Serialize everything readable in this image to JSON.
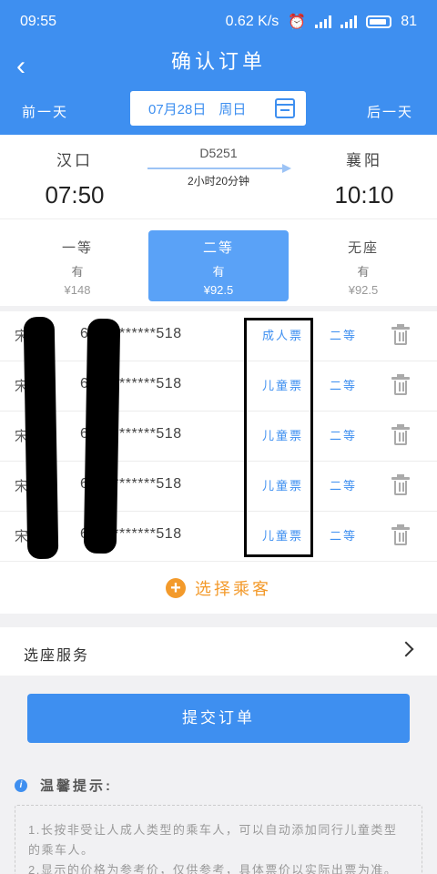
{
  "status_bar": {
    "time": "09:55",
    "speed": "0.62 K/s",
    "battery": "81"
  },
  "header": {
    "title": "确认订单"
  },
  "date_bar": {
    "prev_day": "前一天",
    "date": "07月28日",
    "weekday": "周日",
    "next_day": "后一天"
  },
  "train": {
    "number": "D5251",
    "duration": "2小时20分钟",
    "from_station": "汉口",
    "from_time": "07:50",
    "to_station": "襄阳",
    "to_time": "10:10"
  },
  "seats": [
    {
      "type": "一等",
      "availability": "有",
      "price": "¥148"
    },
    {
      "type": "二等",
      "availability": "有",
      "price": "¥92.5"
    },
    {
      "type": "无座",
      "availability": "有",
      "price": "¥92.5"
    }
  ],
  "selected_seat": 1,
  "passengers": [
    {
      "name": "宋",
      "id": "6***********518",
      "ticket_type": "成人票",
      "seat": "二等"
    },
    {
      "name": "宋",
      "id": "6***********518",
      "ticket_type": "儿童票",
      "seat": "二等"
    },
    {
      "name": "宋",
      "id": "6***********518",
      "ticket_type": "儿童票",
      "seat": "二等"
    },
    {
      "name": "宋",
      "id": "6***********518",
      "ticket_type": "儿童票",
      "seat": "二等"
    },
    {
      "name": "宋",
      "id": "6***********518",
      "ticket_type": "儿童票",
      "seat": "二等"
    }
  ],
  "add_passenger": "选择乘客",
  "seat_service": "选座服务",
  "submit": "提交订单",
  "tips": {
    "title": "温馨提示:",
    "lines": [
      "1.长按非受让人成人类型的乘车人，可以自动添加同行儿童类型的乘车人。",
      "2.显示的价格为参考价，仅供参考，具体票价以实际出票为准。"
    ]
  },
  "colors": {
    "primary": "#3e8ff0",
    "accent": "#f39a2b",
    "selected_seat": "#5aa2f7"
  }
}
